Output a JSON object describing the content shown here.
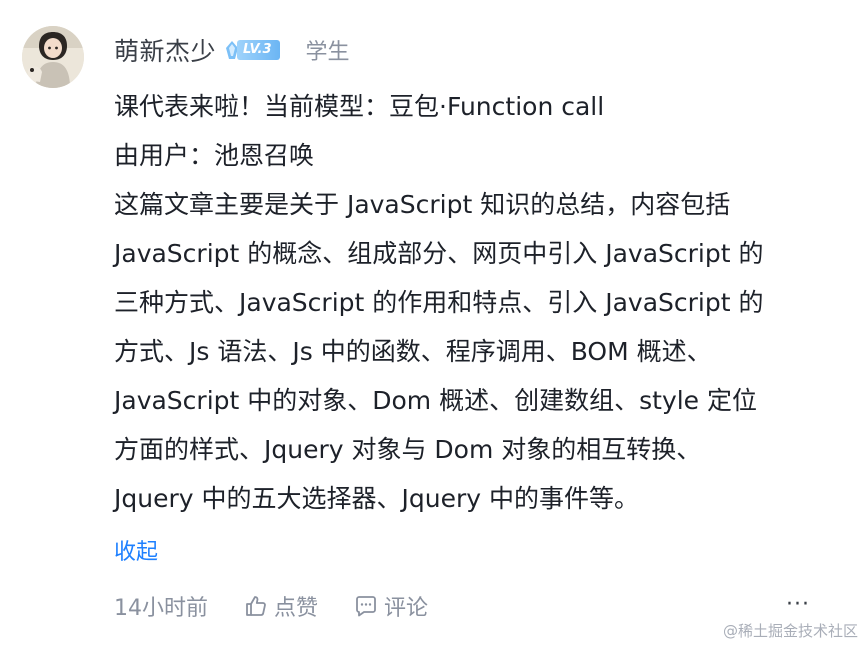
{
  "user": {
    "name": "萌新杰少",
    "level": "LV.3",
    "role": "学生",
    "avatar_icon": "avatar-anime-girl"
  },
  "comment": {
    "lines": [
      "课代表来啦！当前模型：豆包·Function call",
      "由用户：池恩召唤",
      "这篇文章主要是关于 JavaScript 知识的总结，内容包括",
      "JavaScript 的概念、组成部分、网页中引入 JavaScript 的",
      "三种方式、JavaScript 的作用和特点、引入 JavaScript 的",
      "方式、Js 语法、Js 中的函数、程序调用、BOM 概述、",
      "JavaScript 中的对象、Dom 概述、创建数组、style 定位",
      "方面的样式、Jquery 对象与 Dom 对象的相互转换、",
      "Jquery 中的五大选择器、Jquery 中的事件等。"
    ],
    "collapse_label": "收起"
  },
  "actions": {
    "time": "14小时前",
    "like_label": "点赞",
    "comment_label": "评论",
    "more_label": "···",
    "like_icon": "thumbs-up-icon",
    "comment_icon": "comment-bubble-icon"
  },
  "watermark": "@稀土掘金技术社区",
  "colors": {
    "link": "#1e80ff",
    "text": "#1d2129",
    "muted": "#8a919f",
    "badge": "#6bb5f4"
  }
}
